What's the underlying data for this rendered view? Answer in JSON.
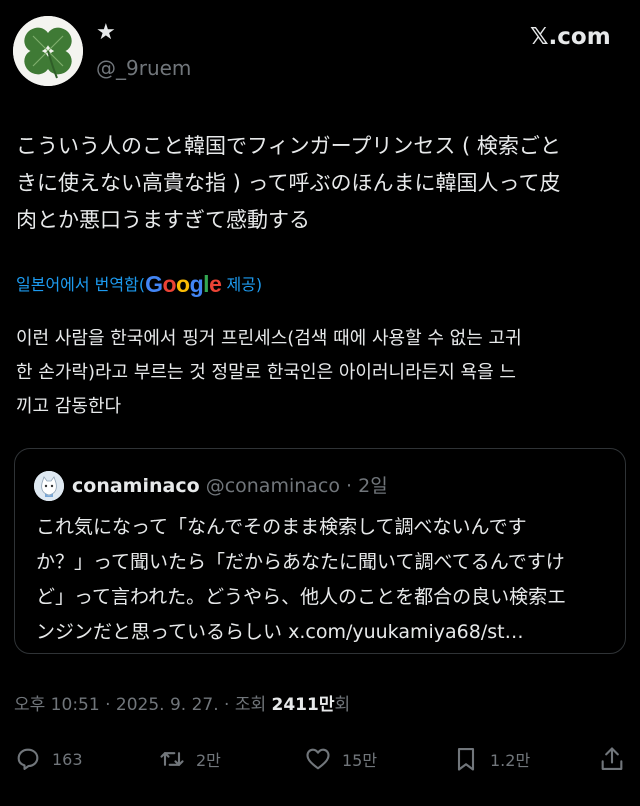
{
  "colors": {
    "background": "#000000",
    "text": "#e7e9ea",
    "muted": "#71767b",
    "link": "#1d9bf0",
    "border": "#2f3336"
  },
  "author": {
    "display_name": "★",
    "handle": "@_9ruem",
    "avatar_icon": "four-leaf-clover-icon"
  },
  "brand": {
    "logo_text": "𝕏.com"
  },
  "tweet": {
    "text": "こういう人のこと韓国でフィンガープリンセス ( 検索ごと\nきに使えない高貴な指 ) って呼ぶのほんまに韓国人って皮\n肉とか悪口うますぎて感動する",
    "translation_label_prefix": "일본어에서 번역함(",
    "translation_provider": "Google",
    "translation_label_suffix": " 제공)",
    "translated_text": "이런 사람을 한국에서 핑거 프린세스(검색 때에 사용할 수 없는 고귀\n한 손가락)라고 부르는 것 정말로 한국인은 아이러니라든지 욕을 느\n끼고 감동한다"
  },
  "quote": {
    "author": "conaminaco",
    "handle": "@conaminaco",
    "separator": " · ",
    "time": "2일",
    "text": "これ気になって「なんでそのまま検索して調べないんです\nか？」って聞いたら「だからあなたに聞いて調べてるんですけ\nど」って言われた。どうやら、他人のことを都合の良い検索エ\nンジンだと思っているらしい x.com/yuukamiya68/st…"
  },
  "meta": {
    "timestamp": "오후 10:51 · 2025. 9. 27. · 조회 ",
    "views": "2411만",
    "views_suffix": "회"
  },
  "actions": {
    "replies": {
      "icon": "reply-icon",
      "count": "163"
    },
    "reposts": {
      "icon": "repost-icon",
      "count": "2만"
    },
    "likes": {
      "icon": "heart-icon",
      "count": "15만"
    },
    "bookmarks": {
      "icon": "bookmark-icon",
      "count": "1.2만"
    },
    "share": {
      "icon": "share-icon"
    }
  }
}
